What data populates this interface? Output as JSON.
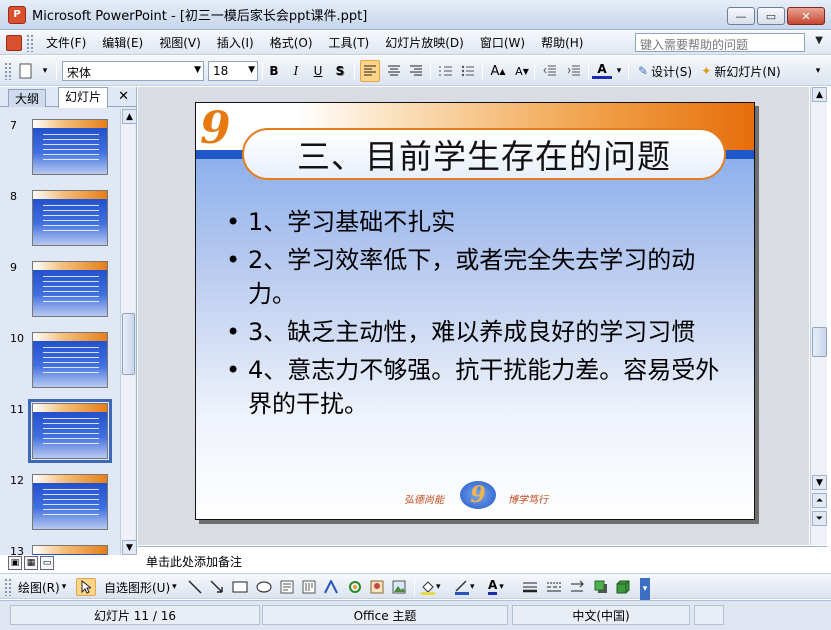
{
  "window": {
    "app_icon_label": "P",
    "title": "Microsoft PowerPoint - [初三一模后家长会ppt课件.ppt]",
    "minimize": "—",
    "restore": "▭",
    "close": "✕"
  },
  "menu": {
    "items": [
      "文件(F)",
      "编辑(E)",
      "视图(V)",
      "插入(I)",
      "格式(O)",
      "工具(T)",
      "幻灯片放映(D)",
      "窗口(W)",
      "帮助(H)"
    ],
    "help_placeholder": "键入需要帮助的问题",
    "help_dropdown": "▼"
  },
  "toolbar": {
    "font_name": "宋体",
    "font_size": "18",
    "bold": "B",
    "italic": "I",
    "underline": "U",
    "shadow": "S",
    "design_label": "设计(S)",
    "new_slide_label": "新幻灯片(N)"
  },
  "left_pane": {
    "tab_outline": "大纲",
    "tab_slides": "幻灯片",
    "close": "✕",
    "thumbnails": [
      {
        "num": "7"
      },
      {
        "num": "8"
      },
      {
        "num": "9"
      },
      {
        "num": "10"
      },
      {
        "num": "11"
      },
      {
        "num": "12"
      },
      {
        "num": "13"
      }
    ],
    "selected": "11"
  },
  "slide": {
    "title": "三、目前学生存在的问题",
    "bullets": [
      "1、学习基础不扎实",
      "2、学习效率低下，或者完全失去学习的动力。",
      "3、缺乏主动性，难以养成良好的学习习惯",
      "4、意志力不够强。抗干扰能力差。容易受外界的干扰。"
    ],
    "logo_mark": "9",
    "footer_left": "弘德尚能",
    "footer_right": "博学笃行"
  },
  "notes_placeholder": "单击此处添加备注",
  "drawbar": {
    "draw_label": "绘图(R)",
    "autoshapes_label": "自选图形(U)"
  },
  "status": {
    "slide_pos": "幻灯片 11 / 16",
    "theme": "Office 主题",
    "language": "中文(中国)"
  },
  "colors": {
    "accent_orange": "#e67a10",
    "slide_blue": "#1f57c8"
  }
}
